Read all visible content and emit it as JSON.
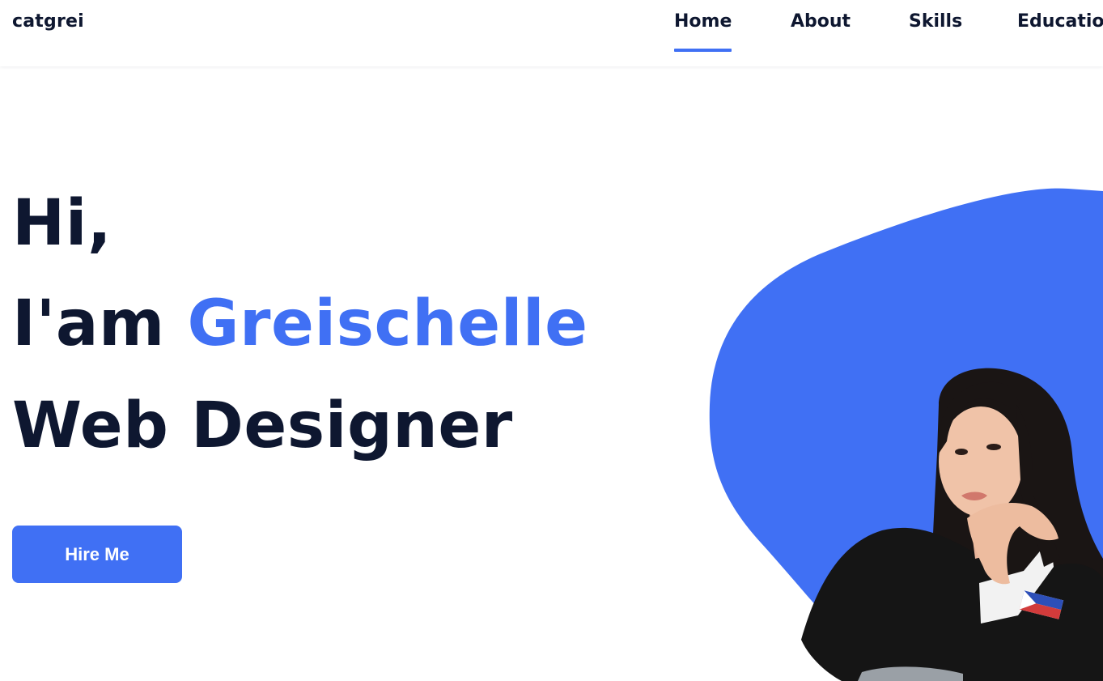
{
  "header": {
    "logo": "catgrei",
    "nav": [
      {
        "label": "Home",
        "active": true
      },
      {
        "label": "About",
        "active": false
      },
      {
        "label": "Skills",
        "active": false
      },
      {
        "label": "Educatio",
        "active": false
      }
    ]
  },
  "hero": {
    "greeting": "Hi,",
    "intro_prefix": "I'am ",
    "name": "Greischelle",
    "role": "Web Designer",
    "cta_label": "Hire Me"
  },
  "portrait": {
    "icon": "profile-photo",
    "has_flag_pin": true
  },
  "colors": {
    "accent": "#4070f4",
    "text": "#0e1730",
    "background": "#ffffff"
  }
}
